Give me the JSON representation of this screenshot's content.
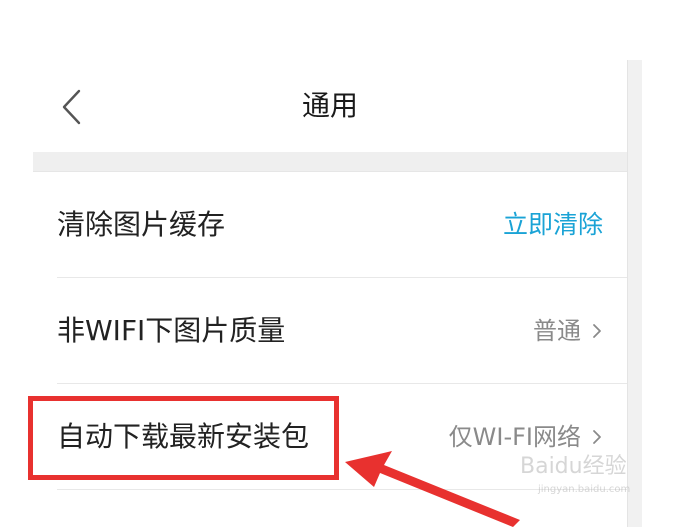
{
  "header": {
    "title": "通用",
    "back_icon": "chevron-left-icon"
  },
  "settings": [
    {
      "label": "清除图片缓存",
      "value": "立即清除",
      "has_chevron": false
    },
    {
      "label": "非WIFI下图片质量",
      "value": "普通",
      "has_chevron": true
    },
    {
      "label": "自动下载最新安装包",
      "value": "仅WI-FI网络",
      "has_chevron": true
    }
  ],
  "annotation": {
    "highlight_color": "#e8312f",
    "arrow_color": "#e8312f"
  },
  "colors": {
    "accent": "#1aa3d6",
    "secondary_text": "#8a8a8a",
    "primary_text": "#222222",
    "separator": "#efefef"
  },
  "watermark": {
    "logo_text": "Baidu经验",
    "url": "jingyan.baidu.com"
  }
}
